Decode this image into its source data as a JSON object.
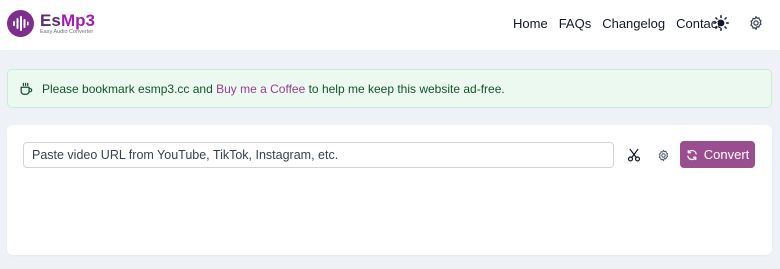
{
  "header": {
    "logo": {
      "es": "Es",
      "mp3": "Mp3",
      "tagline": "Easy Audio Converter"
    },
    "nav": [
      "Home",
      "FAQs",
      "Changelog",
      "Contact"
    ],
    "icons": {
      "theme": "sun-icon",
      "settings": "gear-icon"
    }
  },
  "notice": {
    "before": "Please bookmark esmp3.cc and ",
    "link": "Buy me a Coffee",
    "after": " to help me keep this website ad-free.",
    "icon": "coffee-cup-icon"
  },
  "converter": {
    "placeholder": "Paste video URL from YouTube, TikTok, Instagram, etc.",
    "value": "",
    "convert_label": "Convert",
    "icons": {
      "cut": "scissors-icon",
      "options": "gear-icon",
      "convert": "refresh-icon"
    }
  },
  "colors": {
    "accent": "#9a4d8f",
    "logo_bg": "#7e2f8e",
    "notice_bg": "#ecf9f0",
    "page_bg": "#eef2f7"
  }
}
